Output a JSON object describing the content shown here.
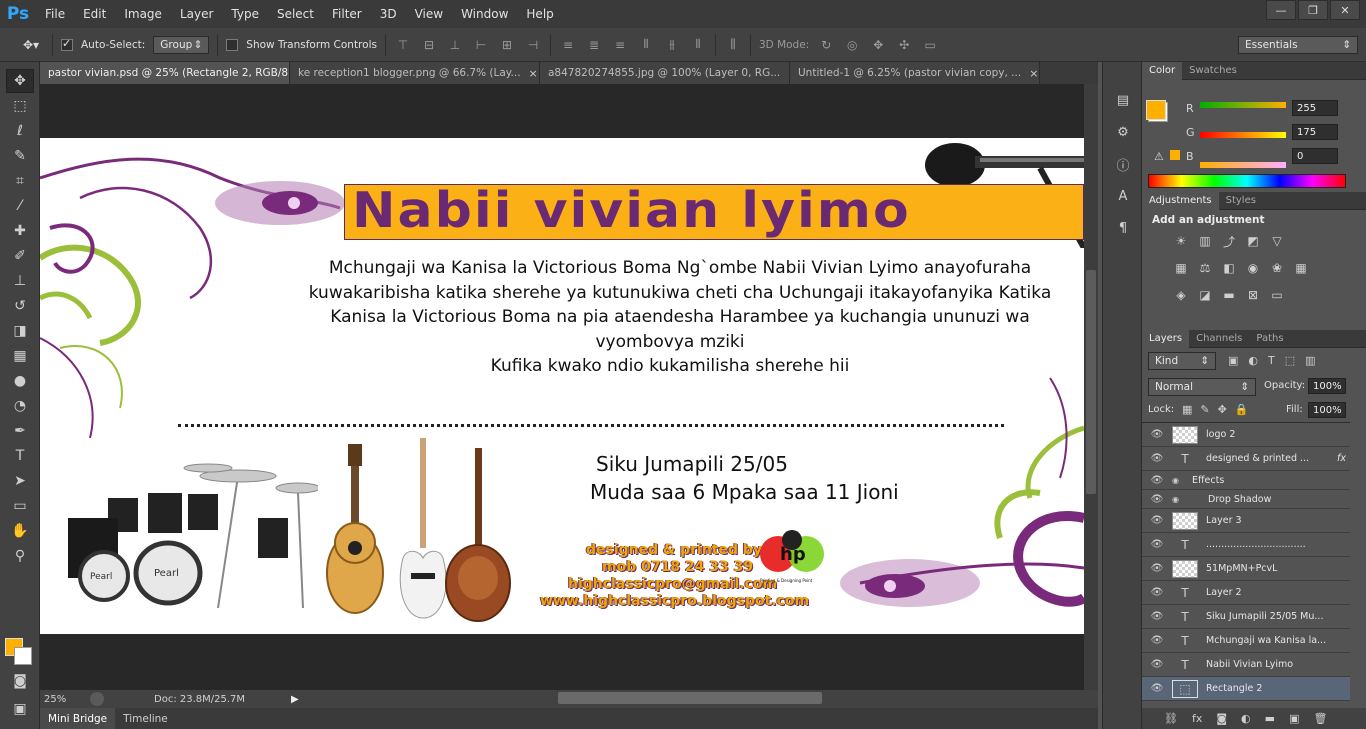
{
  "app": {
    "logo": "Ps"
  },
  "menu": [
    "File",
    "Edit",
    "Image",
    "Layer",
    "Type",
    "Select",
    "Filter",
    "3D",
    "View",
    "Window",
    "Help"
  ],
  "window_controls": {
    "minimize": "—",
    "restore": "❐",
    "close": "✕"
  },
  "options": {
    "auto_select_label": "Auto-Select:",
    "auto_select_value": "Group",
    "transform_label": "Show Transform Controls",
    "mode_3d_label": "3D Mode:",
    "workspace": "Essentials"
  },
  "doc_tabs": [
    {
      "label": "pastor vivian.psd @ 25% (Rectangle 2, RGB/8)",
      "active": true
    },
    {
      "label": "ke reception1 blogger.png @ 66.7% (Lay...",
      "active": false
    },
    {
      "label": "a847820274855.jpg @ 100% (Layer 0, RG...",
      "active": false
    },
    {
      "label": "Untitled-1 @ 6.25% (pastor vivian copy, ...",
      "active": false
    }
  ],
  "artwork": {
    "title": "Nabii vivian lyimo",
    "body_lines": [
      "Mchungaji wa Kanisa la Victorious Boma Ng`ombe  Nabii Vivian Lyimo anayofuraha",
      "kuwakaribisha katika sherehe ya kutunukiwa cheti cha Uchungaji itakayofanyika Katika",
      "Kanisa la Victorious Boma na pia ataendesha Harambee ya kuchangia ununuzi wa",
      "vyombovya mziki",
      "Kufika kwako ndio kukamilisha sherehe hii"
    ],
    "event_day": "Siku Jumapili 25/05",
    "event_time": "Muda saa 6 Mpaka saa 11 Jioni",
    "credit_lines": [
      "designed & printed by",
      "mob 0718 24 33 39",
      "highclassicpro@gmail.com",
      "www.highclassicpro.blogspot.com"
    ],
    "hp_logo": "hp",
    "hp_tagline": "Printing & Designing Point",
    "drum_brand": "Pearl"
  },
  "status": {
    "zoom": "25%",
    "doc": "Doc: 23.8M/25.7M"
  },
  "bottom_tabs": [
    "Mini Bridge",
    "Timeline"
  ],
  "color_panel": {
    "tabs": [
      "Color",
      "Swatches"
    ],
    "r_label": "R",
    "g_label": "G",
    "b_label": "B",
    "r": "255",
    "g": "175",
    "b": "0",
    "fg": "#ffaf00"
  },
  "adjustments_panel": {
    "tabs": [
      "Adjustments",
      "Styles"
    ],
    "hint": "Add an adjustment"
  },
  "layers_panel": {
    "tabs": [
      "Layers",
      "Channels",
      "Paths"
    ],
    "kind": "Kind",
    "blend": "Normal",
    "opacity_label": "Opacity:",
    "opacity": "100%",
    "lock_label": "Lock:",
    "fill_label": "Fill:",
    "fill": "100%",
    "layers": [
      {
        "name": "logo 2",
        "type": "raster",
        "selected": false
      },
      {
        "name": "designed & printed ...",
        "type": "text",
        "fx": "fx",
        "selected": false
      },
      {
        "name": "Effects",
        "type": "effects",
        "selected": false
      },
      {
        "name": "Drop Shadow",
        "type": "effect",
        "selected": false
      },
      {
        "name": "Layer 3",
        "type": "raster",
        "selected": false
      },
      {
        "name": ".................................",
        "type": "text",
        "selected": false
      },
      {
        "name": "51MpMN+PcvL",
        "type": "raster",
        "selected": false
      },
      {
        "name": "Layer 2",
        "type": "text",
        "selected": false
      },
      {
        "name": "Siku Jumapili 25/05  Mu...",
        "type": "text",
        "selected": false
      },
      {
        "name": "Mchungaji wa Kanisa la...",
        "type": "text",
        "selected": false
      },
      {
        "name": "Nabii Vivian Lyimo",
        "type": "text",
        "selected": false
      },
      {
        "name": "Rectangle 2",
        "type": "shape",
        "selected": true
      }
    ]
  }
}
